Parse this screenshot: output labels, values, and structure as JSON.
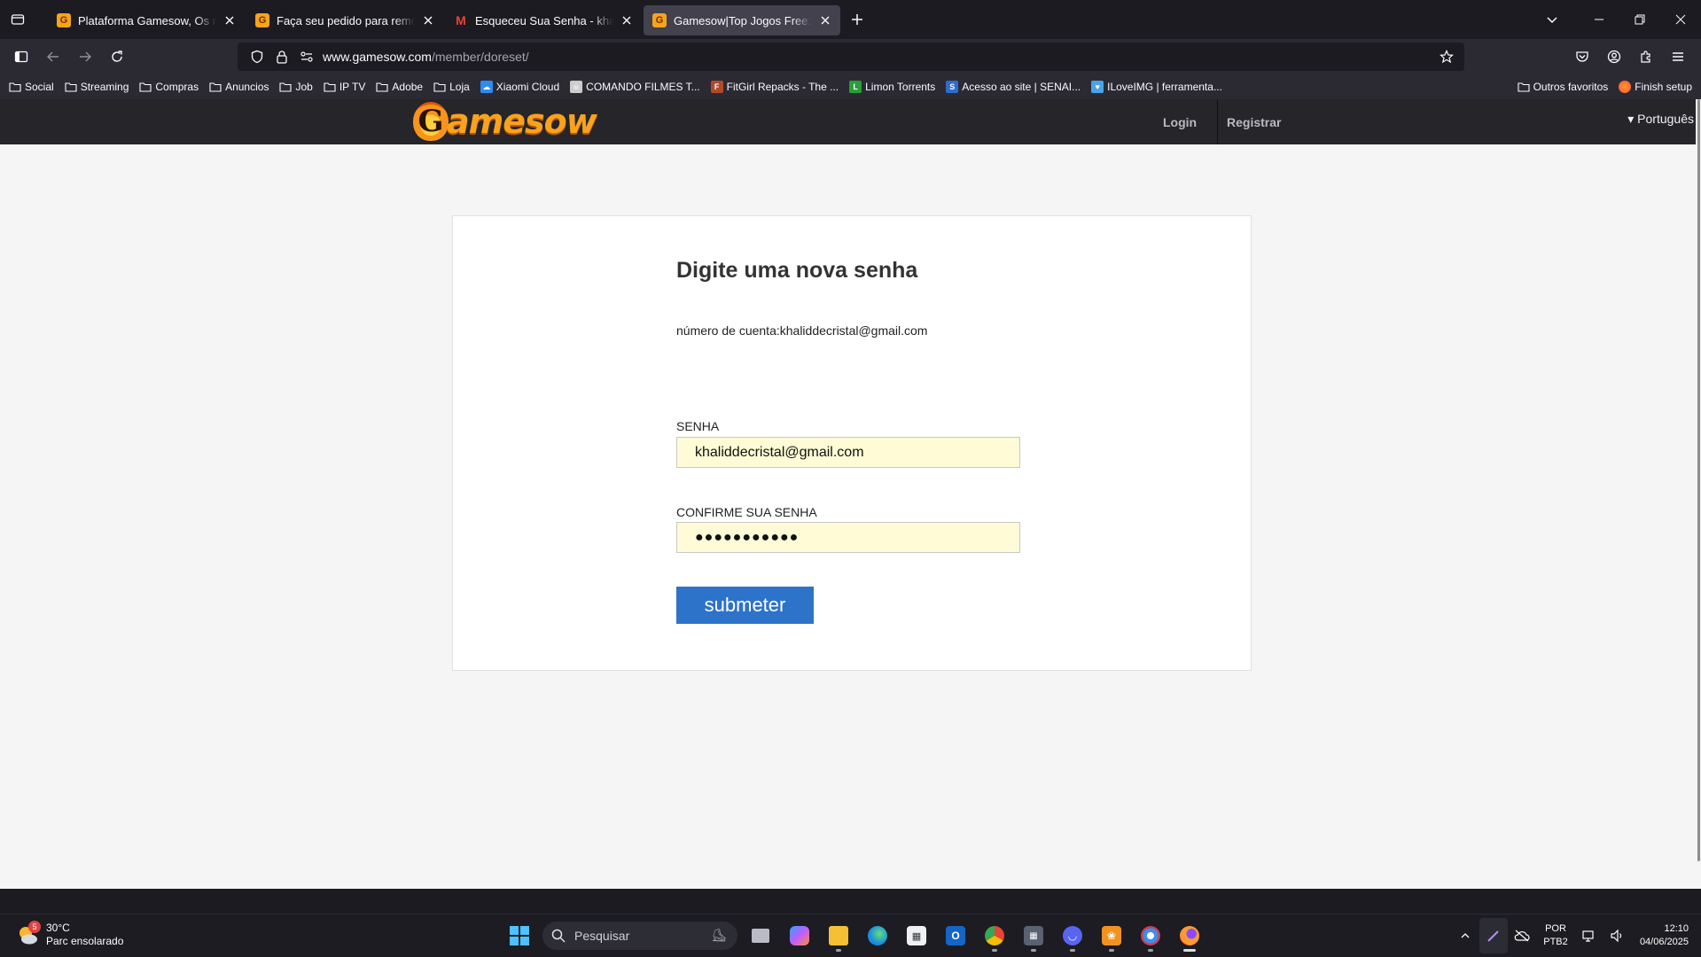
{
  "browser": {
    "tabs": [
      {
        "title": "Plataforma Gamesow,  Os melhores",
        "favicon": "G",
        "type": "gamesow"
      },
      {
        "title": "Faça seu pedido para remoção de",
        "favicon": "G",
        "type": "gamesow"
      },
      {
        "title": "Esqueceu Sua Senha - khaliddecristal",
        "favicon": "M",
        "type": "gmail"
      },
      {
        "title": "Gamesow|Top Jogos Free::member",
        "favicon": "G",
        "type": "gamesow",
        "active": true
      }
    ],
    "url_host": "www.gamesow.com",
    "url_path": "/member/doreset/",
    "bookmarks": [
      {
        "label": "Social",
        "icon": "folder-icon"
      },
      {
        "label": "Streaming",
        "icon": "folder-icon"
      },
      {
        "label": "Compras",
        "icon": "folder-icon"
      },
      {
        "label": "Anuncios",
        "icon": "folder-icon"
      },
      {
        "label": "Job",
        "icon": "folder-icon"
      },
      {
        "label": "IP TV",
        "icon": "folder-icon"
      },
      {
        "label": "Adobe",
        "icon": "folder-icon"
      },
      {
        "label": "Loja",
        "icon": "folder-icon"
      },
      {
        "label": "Xiaomi Cloud",
        "icon": "cloud-icon",
        "color": "#2e8cf0"
      },
      {
        "label": "COMANDO FILMES T...",
        "icon": "skull-icon",
        "color": "#cccccc"
      },
      {
        "label": "FitGirl Repacks - The ...",
        "icon": "fitgirl-icon",
        "color": "#b04a2a"
      },
      {
        "label": "Limon Torrents",
        "icon": "limon-icon",
        "color": "#2a9d3a"
      },
      {
        "label": "Acesso ao site | SENAI...",
        "icon": "senai-icon",
        "color": "#2e6cd1"
      },
      {
        "label": "ILoveIMG | ferramenta...",
        "icon": "heart-icon",
        "color": "#4aa3e8"
      }
    ],
    "bookmarks_right": [
      {
        "label": "Outros favoritos",
        "icon": "folder-icon"
      },
      {
        "label": "Finish setup",
        "icon": "firefox-icon"
      }
    ]
  },
  "site": {
    "nav": {
      "login": "Login",
      "register": "Registrar",
      "language": "▾ Português"
    },
    "form": {
      "title": "Digite uma nova senha",
      "account_label": "número de cuenta:",
      "account_value": "khaliddecristal@gmail.com",
      "password_label": "SENHA",
      "password_value": "khaliddecristal@gmail.com",
      "confirm_label": "CONFIRME SUA SENHA",
      "confirm_value": "●●●●●●●●●●●",
      "submit_label": "submeter"
    },
    "colors": {
      "header_bg": "#25252a",
      "submit_bg": "#2d73c9",
      "field_bg": "#fefbd6",
      "logo": "#f9a21c"
    }
  },
  "taskbar": {
    "weather_temp": "30°C",
    "weather_desc": "Parc ensolarado",
    "weather_badge": "5",
    "search_placeholder": "Pesquisar",
    "lang_top": "POR",
    "lang_bottom": "PTB2",
    "time": "12:10",
    "date": "04/06/2025"
  }
}
